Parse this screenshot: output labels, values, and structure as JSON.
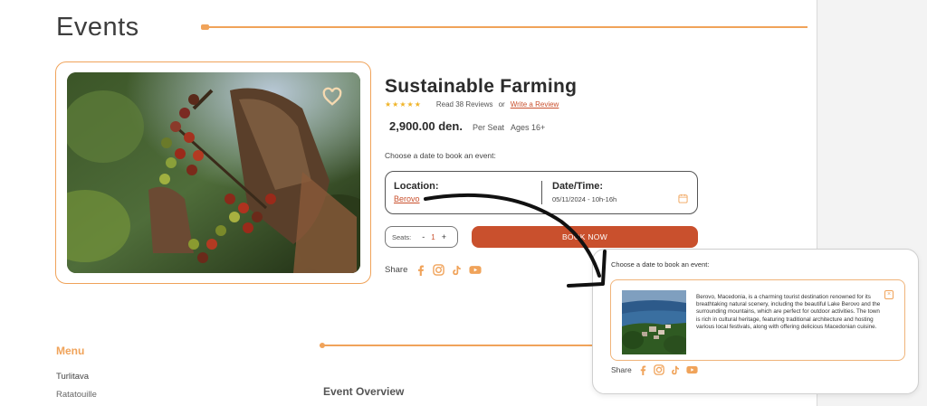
{
  "page": {
    "title": "Events"
  },
  "event": {
    "title": "Sustainable Farming",
    "rating": {
      "stars": "★★★★★",
      "reviews_label": "Read 38 Reviews",
      "or_label": "or",
      "write_review_label": "Write a Review"
    },
    "price": "2,900.00 den.",
    "per_seat": "Per Seat",
    "ages": "Ages 16+",
    "choose_date": "Choose a date to book an event:",
    "location_label": "Location:",
    "location_value": "Berovo",
    "datetime_label": "Date/Time:",
    "datetime_value": "05/11/2024  -  10h-16h",
    "seats_label": "Seats:",
    "seats_minus": "-",
    "seats_qty": "1",
    "seats_plus": "+",
    "book_label": "BOOK NOW",
    "share_label": "Share"
  },
  "menu": {
    "title": "Menu",
    "items": [
      "Turlitava",
      "Ratatouille"
    ]
  },
  "overview": {
    "title": "Event Overview"
  },
  "popup": {
    "choose_date": "Choose a date to book an event:",
    "description": "Berovo, Macedonia, is a charming tourist destination renowned for its breathtaking natural scenery, including the beautiful Lake Berovo and the surrounding mountains, which are perfect for outdoor activities. The town is rich in cultural heritage, featuring traditional architecture and hosting various local festivals, along with offering delicious Macedonian cuisine.",
    "close_symbol": "×",
    "share_label": "Share"
  },
  "colors": {
    "accent": "#f0a35a",
    "brand": "#c9502d",
    "star": "#f0b429"
  },
  "icons": [
    "heart-icon",
    "calendar-icon",
    "facebook-icon",
    "instagram-icon",
    "tiktok-icon",
    "youtube-icon",
    "close-icon"
  ]
}
